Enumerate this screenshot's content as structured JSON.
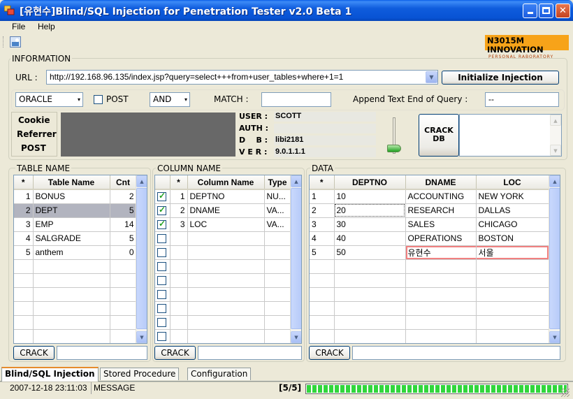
{
  "window": {
    "title": "[유현수]Blind/SQL Injection for Penetration Tester v2.0 Beta 1"
  },
  "menu": {
    "file": "File",
    "help": "Help"
  },
  "logo": {
    "title": "N3015M  INNOVATION",
    "subtitle": "PERSONAL  RABORATORY"
  },
  "information": {
    "label": "INFORMATION",
    "url_label": "URL :",
    "url_value": "http://192.168.96.135/index.jsp?query=select+++from+user_tables+where+1=1",
    "init_button": "Initialize Injection",
    "db_type": "ORACLE",
    "post_label": "POST",
    "operator": "AND",
    "match_label": "MATCH :",
    "match_value": "",
    "append_label": "Append Text End of Query :",
    "append_value": "--",
    "side_tabs": [
      "Cookie",
      "Referrer",
      "POST"
    ],
    "user_label": "USER :",
    "user_value": "SCOTT",
    "auth_label": "AUTH :",
    "auth_value": "",
    "db_label": "D    B :",
    "db_value": "libi2181",
    "ver_label": "V E R :",
    "ver_value": "9.0.1.1.1",
    "crack_db_button": "CRACK\nDB"
  },
  "table_name": {
    "label": "TABLE NAME",
    "headers": [
      "*",
      "Table Name",
      "Cnt"
    ],
    "rows": [
      {
        "n": "1",
        "name": "BONUS",
        "cnt": "2"
      },
      {
        "n": "2",
        "name": "DEPT",
        "cnt": "5"
      },
      {
        "n": "3",
        "name": "EMP",
        "cnt": "14"
      },
      {
        "n": "4",
        "name": "SALGRADE",
        "cnt": "5"
      },
      {
        "n": "5",
        "name": "anthem",
        "cnt": "0"
      }
    ],
    "crack_button": "CRACK"
  },
  "column_name": {
    "label": "COLUMN NAME",
    "headers": [
      "",
      "*",
      "Column Name",
      "Type"
    ],
    "rows": [
      {
        "checked": true,
        "n": "1",
        "name": "DEPTNO",
        "type": "NU..."
      },
      {
        "checked": true,
        "n": "2",
        "name": "DNAME",
        "type": "VA..."
      },
      {
        "checked": true,
        "n": "3",
        "name": "LOC",
        "type": "VA..."
      }
    ],
    "crack_button": "CRACK"
  },
  "data": {
    "label": "DATA",
    "headers": [
      "*",
      "DEPTNO",
      "DNAME",
      "LOC"
    ],
    "rows": [
      [
        "1",
        "10",
        "ACCOUNTING",
        "NEW YORK"
      ],
      [
        "2",
        "20",
        "RESEARCH",
        "DALLAS"
      ],
      [
        "3",
        "30",
        "SALES",
        "CHICAGO"
      ],
      [
        "4",
        "40",
        "OPERATIONS",
        "BOSTON"
      ],
      [
        "5",
        "50",
        "유현수",
        "서울"
      ]
    ],
    "crack_button": "CRACK"
  },
  "tabs": [
    "Blind/SQL Injection",
    "Stored Procedure",
    "Configuration"
  ],
  "status": {
    "timestamp": "2007-12-18 23:11:03",
    "message": "MESSAGE",
    "count": "[5/5]"
  },
  "colors": {
    "title_blue": "#0853d4",
    "logo_orange": "#f7a319",
    "progress_green": "#31d63c",
    "selected_row": "#b2b4bf"
  }
}
